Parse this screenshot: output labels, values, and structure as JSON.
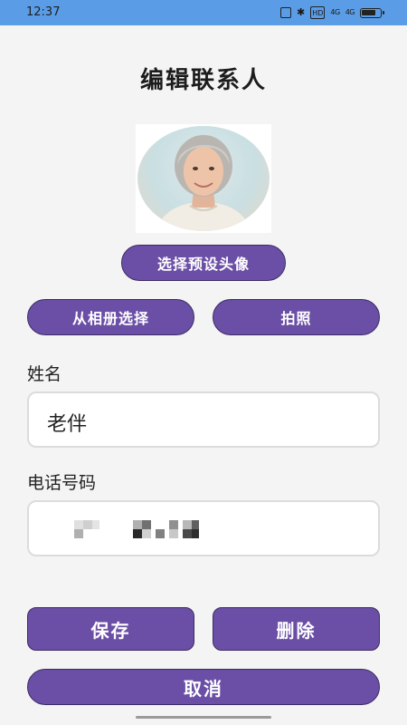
{
  "status_bar": {
    "time": "12:37",
    "icons": [
      "nfc-icon",
      "bluetooth-icon",
      "hd-icon",
      "signal-icon",
      "signal-icon",
      "battery-icon"
    ],
    "hd_label": "HD",
    "signal_label_1": "4G",
    "signal_label_2": "4G",
    "battery_level": 0.8,
    "background_color": "#5a9de6"
  },
  "page": {
    "title": "编辑联系人"
  },
  "avatar": {
    "description_icon": "elderly-woman-portrait"
  },
  "buttons": {
    "preset_avatar": "选择预设头像",
    "from_album": "从相册选择",
    "take_photo": "拍照",
    "save": "保存",
    "delete": "删除",
    "cancel": "取消"
  },
  "form": {
    "name_label": "姓名",
    "name_value": "老伴",
    "phone_label": "电话号码",
    "phone_value_masked": true
  },
  "colors": {
    "accent": "#6b4fa6",
    "accent_border": "#3b2c63",
    "background": "#f4f4f4"
  }
}
